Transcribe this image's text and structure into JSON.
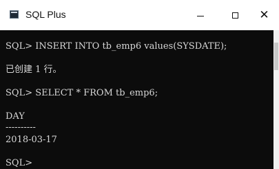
{
  "window": {
    "title": "SQL Plus",
    "icon": "terminal-icon",
    "controls": {
      "minimize": "minimize-icon",
      "maximize": "maximize-icon",
      "close_glyph": "✕"
    }
  },
  "console": {
    "background": "#0c0c0c",
    "text_color": "#d8d8d8",
    "lines": [
      "SQL> INSERT INTO tb_emp6 values(SYSDATE);",
      "已创建 1 行。",
      "SQL> SELECT * FROM tb_emp6;",
      "DAY",
      "----------",
      "2018-03-17",
      "SQL>"
    ]
  }
}
